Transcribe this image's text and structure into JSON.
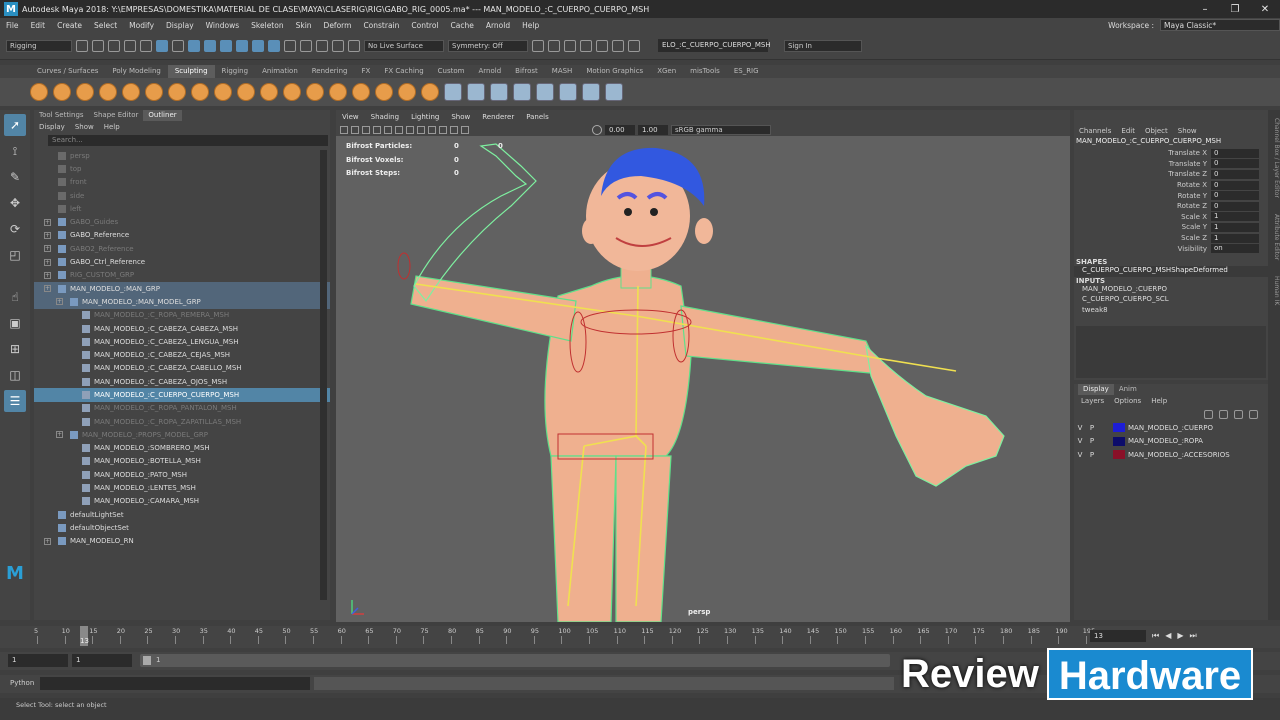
{
  "titlebar": {
    "title": "Autodesk Maya 2018: Y:\\EMPRESAS\\DOMESTIKA\\MATERIAL DE CLASE\\MAYA\\CLASERIG\\RIG\\GABO_RIG_0005.ma*  ---  MAN_MODELO_:C_CUERPO_CUERPO_MSH",
    "logo": "M"
  },
  "menubar": {
    "items": [
      "File",
      "Edit",
      "Create",
      "Select",
      "Modify",
      "Display",
      "Windows",
      "Skeleton",
      "Skin",
      "Deform",
      "Constrain",
      "Control",
      "Cache",
      "Arnold",
      "Help"
    ],
    "workspace_label": "Workspace :",
    "workspace_value": "Maya Classic*"
  },
  "statusline": {
    "menuset": "Rigging",
    "live_surface": "No Live Surface",
    "symmetry": "Symmetry: Off",
    "object_field": "ELO_:C_CUERPO_CUERPO_MSH",
    "sign_in": "Sign In"
  },
  "shelf": {
    "tabs": [
      "Curves / Surfaces",
      "Poly Modeling",
      "Sculpting",
      "Rigging",
      "Animation",
      "Rendering",
      "FX",
      "FX Caching",
      "Custom",
      "Arnold",
      "Bifrost",
      "MASH",
      "Motion Graphics",
      "XGen",
      "misTools",
      "ES_RIG"
    ],
    "active": "Sculpting"
  },
  "outliner": {
    "tabs": [
      "Tool Settings",
      "Shape Editor",
      "Outliner"
    ],
    "menu": [
      "Display",
      "Show",
      "Help"
    ],
    "search_placeholder": "Search...",
    "rows": [
      {
        "label": "persp",
        "indent": 1,
        "dim": true
      },
      {
        "label": "top",
        "indent": 1,
        "dim": true
      },
      {
        "label": "front",
        "indent": 1,
        "dim": true
      },
      {
        "label": "side",
        "indent": 1,
        "dim": true
      },
      {
        "label": "left",
        "indent": 1,
        "dim": true
      },
      {
        "label": "GABO_Guides",
        "indent": 1,
        "dim": true,
        "exp": true
      },
      {
        "label": "GABO_Reference",
        "indent": 1,
        "exp": true
      },
      {
        "label": "GABO2_Reference",
        "indent": 1,
        "dim": true,
        "exp": true
      },
      {
        "label": "GABO_Ctrl_Reference",
        "indent": 1,
        "exp": true
      },
      {
        "label": "RIG_CUSTOM_GRP",
        "indent": 1,
        "dim": true,
        "exp": true
      },
      {
        "label": "MAN_MODELO_:MAN_GRP",
        "indent": 1,
        "exp": true,
        "hl": true
      },
      {
        "label": "MAN_MODELO_:MAN_MODEL_GRP",
        "indent": 2,
        "exp": true,
        "hl": true
      },
      {
        "label": "MAN_MODELO_:C_ROPA_REMERA_MSH",
        "indent": 3,
        "dim": true
      },
      {
        "label": "MAN_MODELO_:C_CABEZA_CABEZA_MSH",
        "indent": 3
      },
      {
        "label": "MAN_MODELO_:C_CABEZA_LENGUA_MSH",
        "indent": 3
      },
      {
        "label": "MAN_MODELO_:C_CABEZA_CEJAS_MSH",
        "indent": 3
      },
      {
        "label": "MAN_MODELO_:C_CABEZA_CABELLO_MSH",
        "indent": 3
      },
      {
        "label": "MAN_MODELO_:C_CABEZA_OJOS_MSH",
        "indent": 3
      },
      {
        "label": "MAN_MODELO_:C_CUERPO_CUERPO_MSH",
        "indent": 3,
        "sel": true
      },
      {
        "label": "MAN_MODELO_:C_ROPA_PANTALON_MSH",
        "indent": 3,
        "dim": true
      },
      {
        "label": "MAN_MODELO_:C_ROPA_ZAPATILLAS_MSH",
        "indent": 3,
        "dim": true
      },
      {
        "label": "MAN_MODELO_:PROPS_MODEL_GRP",
        "indent": 2,
        "dim": true,
        "exp": true
      },
      {
        "label": "MAN_MODELO_:SOMBRERO_MSH",
        "indent": 3
      },
      {
        "label": "MAN_MODELO_:BOTELLA_MSH",
        "indent": 3
      },
      {
        "label": "MAN_MODELO_:PATO_MSH",
        "indent": 3
      },
      {
        "label": "MAN_MODELO_:LENTES_MSH",
        "indent": 3
      },
      {
        "label": "MAN_MODELO_:CAMARA_MSH",
        "indent": 3
      },
      {
        "label": "defaultLightSet",
        "indent": 1
      },
      {
        "label": "defaultObjectSet",
        "indent": 1
      },
      {
        "label": "MAN_MODELO_RN",
        "indent": 1,
        "exp": true
      }
    ]
  },
  "viewport": {
    "menu": [
      "View",
      "Shading",
      "Lighting",
      "Show",
      "Renderer",
      "Panels"
    ],
    "exposure": "0.00",
    "gamma": "1.00",
    "colorspace": "sRGB gamma",
    "camera": "persp",
    "hud": [
      {
        "label": "Bifrost Particles:",
        "a": "0",
        "b": "0"
      },
      {
        "label": "Bifrost Voxels:",
        "a": "0",
        "b": ""
      },
      {
        "label": "Bifrost Steps:",
        "a": "0",
        "b": ""
      }
    ]
  },
  "channelbox": {
    "menu": [
      "Channels",
      "Edit",
      "Object",
      "Show"
    ],
    "object": "MAN_MODELO_:C_CUERPO_CUERPO_MSH",
    "attrs": [
      {
        "name": "Translate X",
        "value": "0"
      },
      {
        "name": "Translate Y",
        "value": "0"
      },
      {
        "name": "Translate Z",
        "value": "0"
      },
      {
        "name": "Rotate X",
        "value": "0"
      },
      {
        "name": "Rotate Y",
        "value": "0"
      },
      {
        "name": "Rotate Z",
        "value": "0"
      },
      {
        "name": "Scale X",
        "value": "1"
      },
      {
        "name": "Scale Y",
        "value": "1"
      },
      {
        "name": "Scale Z",
        "value": "1"
      },
      {
        "name": "Visibility",
        "value": "on"
      }
    ],
    "shapes_header": "SHAPES",
    "shapes": [
      "C_CUERPO_CUERPO_MSHShapeDeformed"
    ],
    "inputs_header": "INPUTS",
    "inputs": [
      "MAN_MODELO_:CUERPO",
      "C_CUERPO_CUERPO_SCL",
      "tweak8"
    ]
  },
  "layers": {
    "tabs": [
      "Display",
      "Anim"
    ],
    "menu": [
      "Layers",
      "Options",
      "Help"
    ],
    "rows": [
      {
        "v": "V",
        "p": "P",
        "color": "#1d1dd6",
        "name": "MAN_MODELO_:CUERPO"
      },
      {
        "v": "V",
        "p": "P",
        "color": "#0c0c6a",
        "name": "MAN_MODELO_:ROPA"
      },
      {
        "v": "V",
        "p": "P",
        "color": "#8a1028",
        "name": "MAN_MODELO_:ACCESORIOS"
      }
    ]
  },
  "sidetabs": {
    "a": "Channel Box / Layer Editor",
    "b": "Attribute Editor",
    "c": "Human IK"
  },
  "timeline": {
    "ticks": [
      "5",
      "10",
      "15",
      "20",
      "25",
      "30",
      "35",
      "40",
      "45",
      "50",
      "55",
      "60",
      "65",
      "70",
      "75",
      "80",
      "85",
      "90",
      "95",
      "100",
      "105",
      "110",
      "115",
      "120",
      "125",
      "130",
      "135",
      "140",
      "145",
      "150",
      "155",
      "160",
      "165",
      "170",
      "175",
      "180",
      "185",
      "190",
      "195"
    ],
    "current": "13",
    "current_field": "13"
  },
  "range": {
    "start": "1",
    "inner_start": "1",
    "slider_label": "1"
  },
  "cmd": {
    "lang": "Python"
  },
  "help": {
    "text": "Select Tool: select an object"
  },
  "watermark": {
    "a": "Review",
    "b": "Hardware"
  }
}
